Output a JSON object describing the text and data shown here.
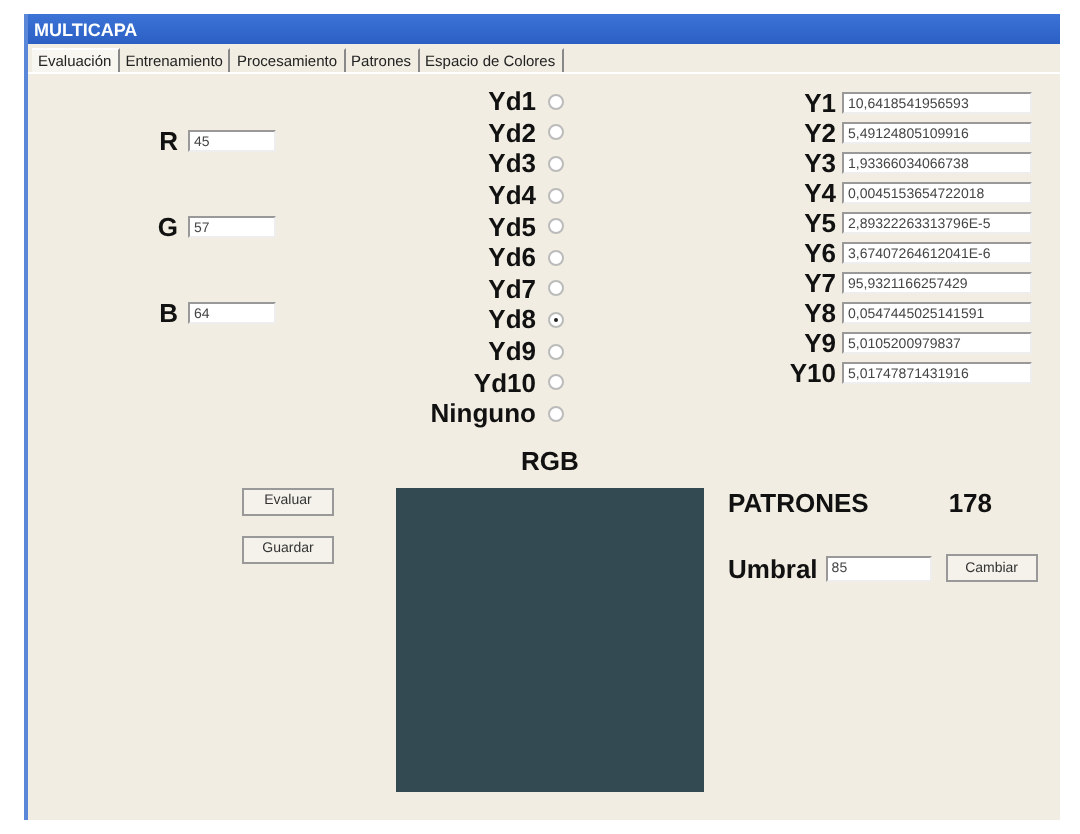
{
  "window": {
    "title": "MULTICAPA"
  },
  "tabs": [
    {
      "label": "Evaluación",
      "selected": true
    },
    {
      "label": "Entrenamiento",
      "selected": false
    },
    {
      "label": "Procesamiento",
      "selected": false
    },
    {
      "label": "Patrones",
      "selected": false
    },
    {
      "label": "Espacio de Colores",
      "selected": false
    }
  ],
  "rgb_inputs": [
    {
      "label": "R",
      "value": "45"
    },
    {
      "label": "G",
      "value": "57"
    },
    {
      "label": "B",
      "value": "64"
    }
  ],
  "targets": [
    {
      "label": "Yd1",
      "selected": false
    },
    {
      "label": "Yd2",
      "selected": false
    },
    {
      "label": "Yd3",
      "selected": false
    },
    {
      "label": "Yd4",
      "selected": false
    },
    {
      "label": "Yd5",
      "selected": false
    },
    {
      "label": "Yd6",
      "selected": false
    },
    {
      "label": "Yd7",
      "selected": false
    },
    {
      "label": "Yd8",
      "selected": true
    },
    {
      "label": "Yd9",
      "selected": false
    },
    {
      "label": "Yd10",
      "selected": false
    },
    {
      "label": "Ninguno",
      "selected": false
    }
  ],
  "outputs": [
    {
      "label": "Y1",
      "value": "10,6418541956593"
    },
    {
      "label": "Y2",
      "value": "5,49124805109916"
    },
    {
      "label": "Y3",
      "value": "1,93366034066738"
    },
    {
      "label": "Y4",
      "value": "0,0045153654722018"
    },
    {
      "label": "Y5",
      "value": "2,89322263313796E-5"
    },
    {
      "label": "Y6",
      "value": "3,67407264612041E-6"
    },
    {
      "label": "Y7",
      "value": "95,9321166257429"
    },
    {
      "label": "Y8",
      "value": "0,0547445025141591"
    },
    {
      "label": "Y9",
      "value": "5,0105200979837"
    },
    {
      "label": "Y10",
      "value": "5,01747871431916"
    }
  ],
  "buttons": [
    "Evaluar",
    "Guardar"
  ],
  "preview": {
    "label": "RGB",
    "color": "#344a52"
  },
  "patterns": {
    "label": "PATRONES",
    "count": "178"
  },
  "threshold": {
    "label": "Umbral",
    "value": "85",
    "button": "Cambiar"
  }
}
